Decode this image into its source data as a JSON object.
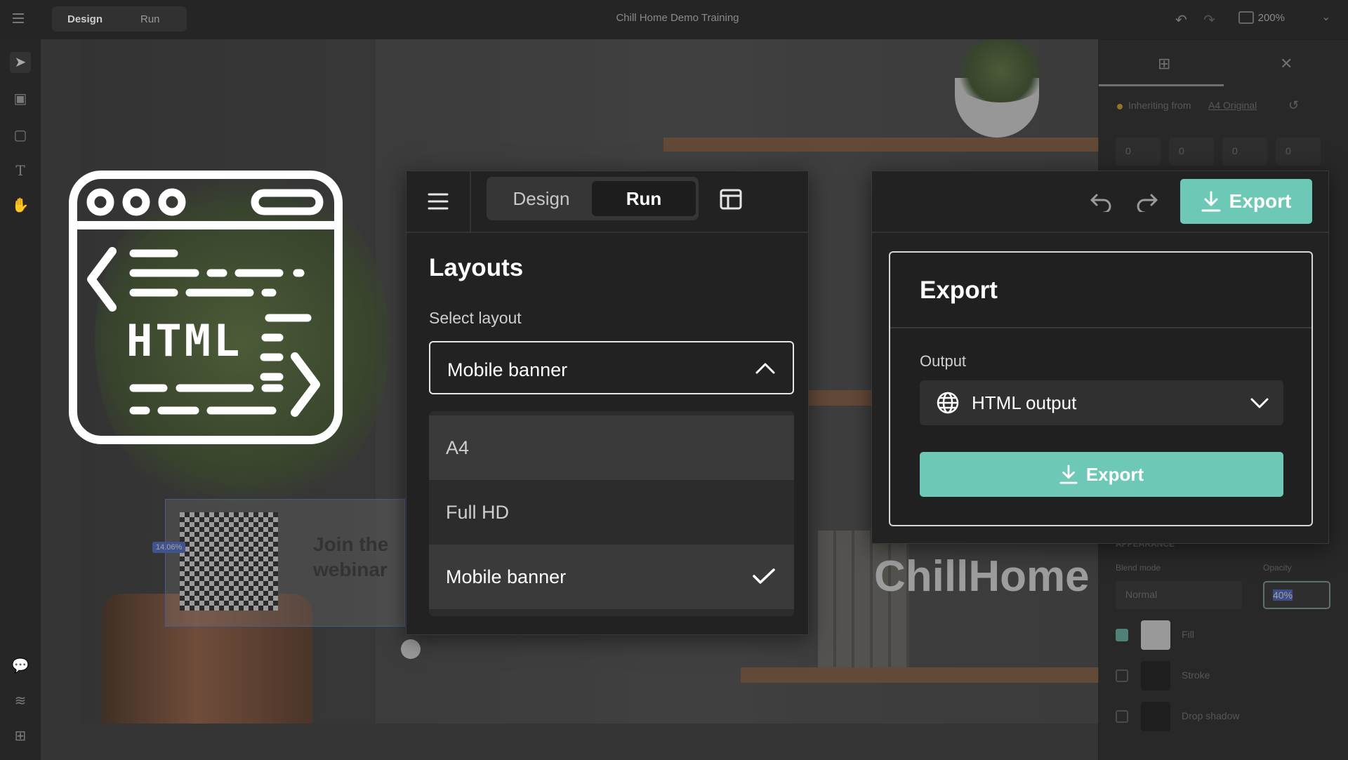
{
  "app": {
    "mode_tabs": [
      "Design",
      "Run"
    ],
    "document_title": "Chill Home Demo Training",
    "zoom": "200%"
  },
  "right_panel_bg": {
    "inheriting_label": "Inheriting from",
    "inheriting_link": "A4 Original",
    "values": [
      "0",
      "0",
      "0",
      "0"
    ],
    "section_label": "APPEARANCE",
    "blend_mode_label": "Blend mode",
    "blend_mode_value": "Normal",
    "opacity_label": "Opacity",
    "opacity_value": "40%",
    "fill_label": "Fill",
    "stroke_label": "Stroke",
    "shadow_label": "Drop shadow",
    "fill_checked": true,
    "stroke_checked": false,
    "shadow_checked": false
  },
  "canvas": {
    "banner_text_line1": "Join the",
    "banner_text_line2": "webinar",
    "brand_text": "ChillHome",
    "size_badge": "14.06%"
  },
  "html_icon": {
    "label": "HTML"
  },
  "layouts_panel": {
    "tabs": {
      "design": "Design",
      "run": "Run",
      "active": "Run"
    },
    "title": "Layouts",
    "select_label": "Select layout",
    "selected": "Mobile banner",
    "options": [
      {
        "label": "A4",
        "selected": false
      },
      {
        "label": "Full HD",
        "selected": false
      },
      {
        "label": "Mobile banner",
        "selected": true
      }
    ]
  },
  "export_panel": {
    "toolbar_button": "Export",
    "title": "Export",
    "output_label": "Output",
    "output_value": "HTML output",
    "export_button": "Export"
  },
  "colors": {
    "accent": "#6ec8b6",
    "panel_bg": "#222222",
    "dropdown_hover": "#3a3a3a",
    "shelf": "#8a5a3a"
  }
}
